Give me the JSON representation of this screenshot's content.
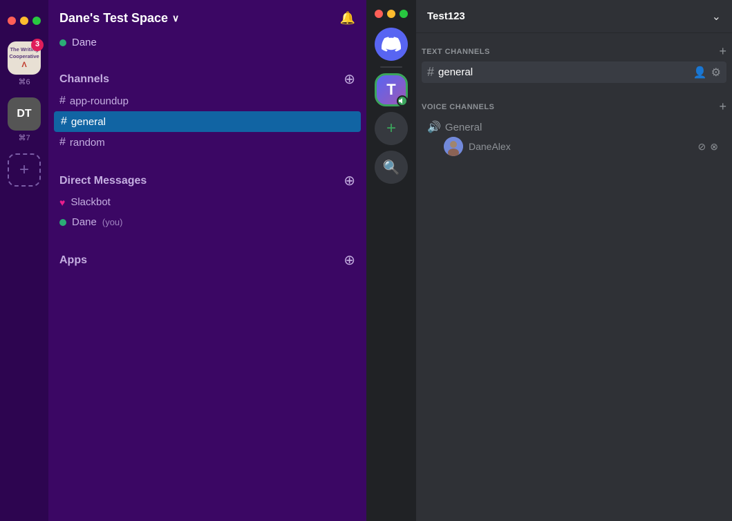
{
  "left": {
    "workspace": {
      "name": "Dane's Test Space",
      "chevron": "∨",
      "bell": "🔔"
    },
    "user": {
      "name": "Dane",
      "status": "online"
    },
    "workspaceIcons": [
      {
        "id": "writing-coop",
        "label": "The Writing\nCooperative",
        "badge": "3",
        "shortcut": "⌘6"
      },
      {
        "id": "dt",
        "label": "DT",
        "shortcut": "⌘7"
      }
    ],
    "channels": {
      "section_label": "Channels",
      "items": [
        {
          "name": "app-roundup",
          "active": false
        },
        {
          "name": "general",
          "active": true
        },
        {
          "name": "random",
          "active": false
        }
      ]
    },
    "direct_messages": {
      "section_label": "Direct Messages",
      "items": [
        {
          "name": "Slackbot",
          "type": "heart"
        },
        {
          "name": "Dane",
          "type": "dot",
          "extra": "(you)"
        }
      ]
    },
    "apps": {
      "section_label": "Apps"
    }
  },
  "right": {
    "server_name": "Test123",
    "text_channels": {
      "section_label": "TEXT CHANNELS",
      "items": [
        {
          "name": "general",
          "active": true
        }
      ]
    },
    "voice_channels": {
      "section_label": "VOICE CHANNELS",
      "items": [
        {
          "name": "General",
          "members": [
            {
              "name": "DaneAlex"
            }
          ]
        }
      ]
    }
  },
  "icons": {
    "add": "+",
    "hash": "#",
    "bell": "🔔",
    "chevron_down": "⌄",
    "speaker": "🔊",
    "mute": "⊘",
    "deafen": "⊗",
    "add_member": "👤+",
    "settings": "⚙"
  }
}
